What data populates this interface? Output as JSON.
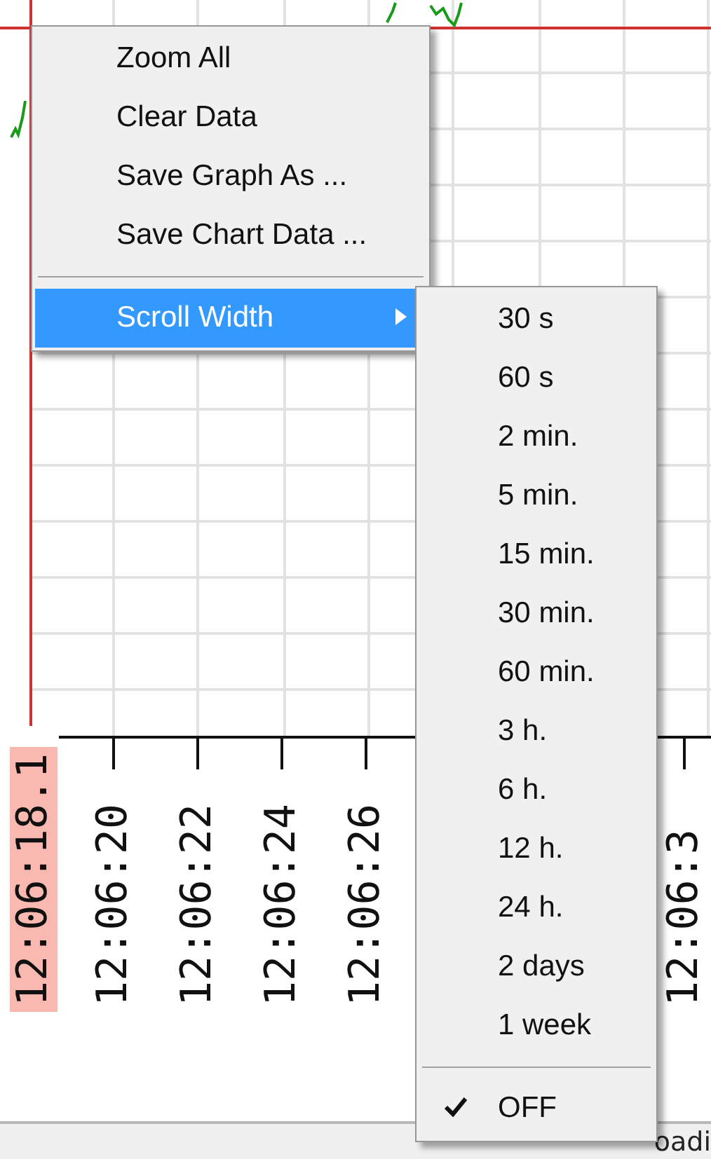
{
  "chart": {
    "x_tick_labels": [
      {
        "text": "12:06:18.1",
        "highlighted": true
      },
      {
        "text": "12:06:20",
        "highlighted": false
      },
      {
        "text": "12:06:22",
        "highlighted": false
      },
      {
        "text": "12:06:24",
        "highlighted": false
      },
      {
        "text": "12:06:26",
        "highlighted": false
      },
      {
        "text": "12:06:3",
        "highlighted": false
      }
    ]
  },
  "context_menu": {
    "items": [
      {
        "kind": "command",
        "label": "Zoom All",
        "selected": false
      },
      {
        "kind": "command",
        "label": "Clear Data",
        "selected": false
      },
      {
        "kind": "command",
        "label": "Save Graph As ...",
        "selected": false
      },
      {
        "kind": "command",
        "label": "Save Chart Data ...",
        "selected": false
      },
      {
        "kind": "separator"
      },
      {
        "kind": "submenu",
        "label": "Scroll Width",
        "selected": true
      }
    ]
  },
  "submenu": {
    "items": [
      {
        "kind": "option",
        "label": "30 s",
        "checked": false
      },
      {
        "kind": "option",
        "label": "60 s",
        "checked": false
      },
      {
        "kind": "option",
        "label": "2 min.",
        "checked": false
      },
      {
        "kind": "option",
        "label": "5 min.",
        "checked": false
      },
      {
        "kind": "option",
        "label": "15 min.",
        "checked": false
      },
      {
        "kind": "option",
        "label": "30 min.",
        "checked": false
      },
      {
        "kind": "option",
        "label": "60 min.",
        "checked": false
      },
      {
        "kind": "option",
        "label": "3 h.",
        "checked": false
      },
      {
        "kind": "option",
        "label": "6 h.",
        "checked": false
      },
      {
        "kind": "option",
        "label": "12 h.",
        "checked": false
      },
      {
        "kind": "option",
        "label": "24 h.",
        "checked": false
      },
      {
        "kind": "option",
        "label": "2 days",
        "checked": false
      },
      {
        "kind": "option",
        "label": "1 week",
        "checked": false
      },
      {
        "kind": "separator"
      },
      {
        "kind": "option",
        "label": "OFF",
        "checked": true
      }
    ]
  },
  "status_bar": {
    "text": "oadi"
  }
}
